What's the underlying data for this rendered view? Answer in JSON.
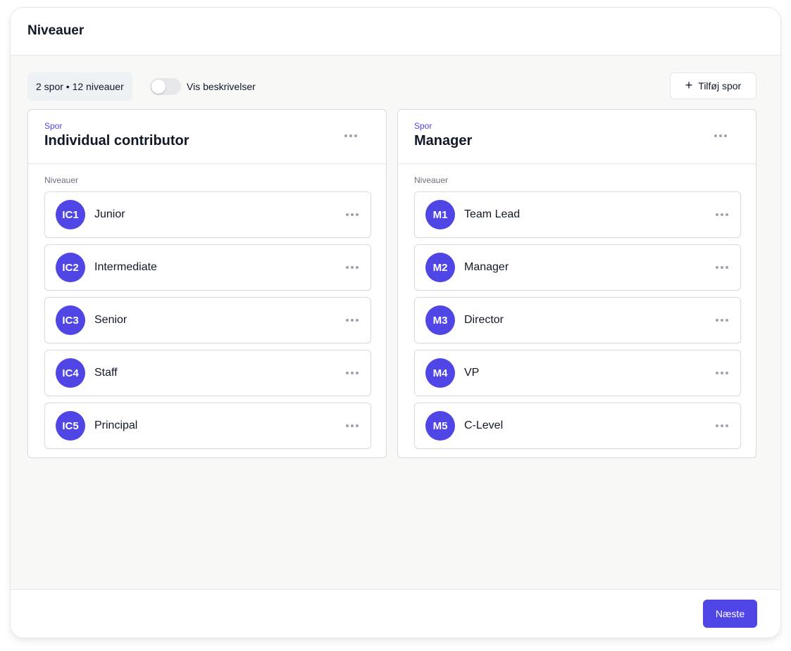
{
  "window": {
    "title": "Niveauer"
  },
  "toolbar": {
    "summary": "2 spor • 12 niveauer",
    "toggle_label": "Vis beskrivelser",
    "toggle_on": false,
    "add_track_label": "Tilføj spor",
    "add_track_icon": "plus-icon"
  },
  "tracks": [
    {
      "kicker": "Spor",
      "title": "Individual contributor",
      "levels_label": "Niveauer",
      "levels": [
        {
          "code": "IC1",
          "name": "Junior"
        },
        {
          "code": "IC2",
          "name": "Intermediate"
        },
        {
          "code": "IC3",
          "name": "Senior"
        },
        {
          "code": "IC4",
          "name": "Staff"
        },
        {
          "code": "IC5",
          "name": "Principal"
        }
      ]
    },
    {
      "kicker": "Spor",
      "title": "Manager",
      "levels_label": "Niveauer",
      "levels": [
        {
          "code": "M1",
          "name": "Team Lead"
        },
        {
          "code": "M2",
          "name": "Manager"
        },
        {
          "code": "M3",
          "name": "Director"
        },
        {
          "code": "M4",
          "name": "VP"
        },
        {
          "code": "M5",
          "name": "C-Level"
        }
      ]
    }
  ],
  "footer": {
    "next_label": "Næste"
  },
  "colors": {
    "accent": "#4f46e5",
    "border": "#d8dce2",
    "content_bg": "#f8f8f7"
  }
}
